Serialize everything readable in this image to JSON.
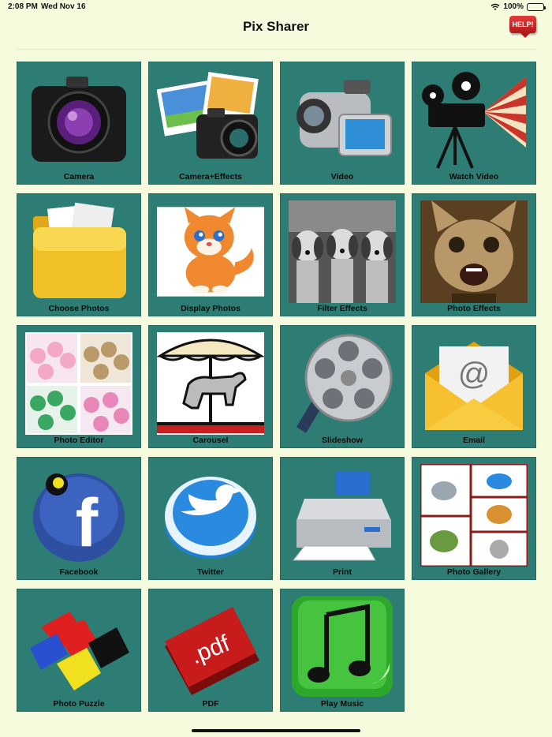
{
  "status": {
    "time": "2:08 PM",
    "date": "Wed Nov 16",
    "battery": "100%"
  },
  "title": "Pix Sharer",
  "help": "HELP!",
  "tiles": [
    {
      "label": "Camera",
      "icon": "camera-icon"
    },
    {
      "label": "Camera+Effects",
      "icon": "camera-effects-icon"
    },
    {
      "label": "Video",
      "icon": "video-camera-icon"
    },
    {
      "label": "Watch Video",
      "icon": "film-projector-icon"
    },
    {
      "label": "Choose Photos",
      "icon": "folder-icon"
    },
    {
      "label": "Display Photos",
      "icon": "cat-icon"
    },
    {
      "label": "Filter Effects",
      "icon": "dogs-photo-icon"
    },
    {
      "label": "Photo Effects",
      "icon": "kitten-photo-icon"
    },
    {
      "label": "Photo Editor",
      "icon": "cupcakes-icon"
    },
    {
      "label": "Carousel",
      "icon": "carousel-icon"
    },
    {
      "label": "Slideshow",
      "icon": "film-reel-icon"
    },
    {
      "label": "Email",
      "icon": "envelope-icon"
    },
    {
      "label": "Facebook",
      "icon": "facebook-icon"
    },
    {
      "label": "Twitter",
      "icon": "twitter-bird-icon"
    },
    {
      "label": "Print",
      "icon": "printer-icon"
    },
    {
      "label": "Photo Gallery",
      "icon": "gallery-icon"
    },
    {
      "label": "Photo Puzzle",
      "icon": "puzzle-icon"
    },
    {
      "label": "PDF",
      "icon": "pdf-icon"
    },
    {
      "label": "Play Music",
      "icon": "music-note-icon"
    }
  ],
  "icon_text": {
    "pdf": ".pdf",
    "email_at": "@",
    "facebook_f": "f"
  },
  "colors": {
    "background": "#f7fbde",
    "tile": "#2e7d75",
    "help": "#cc2222"
  }
}
